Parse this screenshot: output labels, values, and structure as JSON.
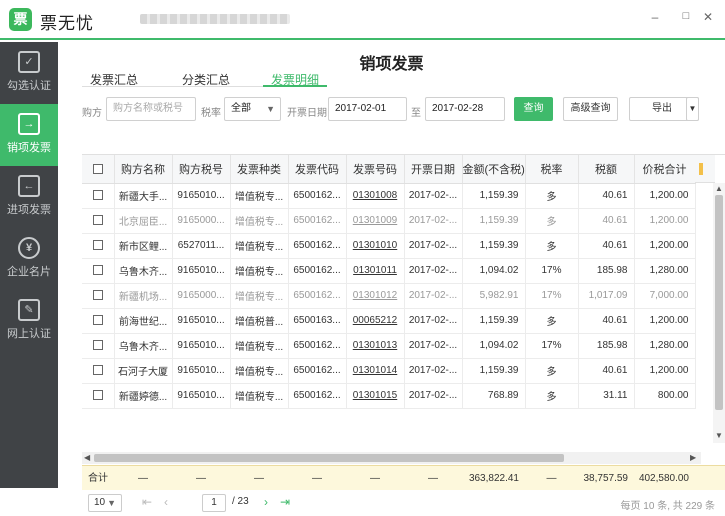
{
  "app": {
    "name": "票无忧",
    "logo_char": "票"
  },
  "window": {
    "minimize": "–",
    "maximize": "□",
    "close": "✕"
  },
  "sidebar": {
    "items": [
      {
        "label": "勾选认证",
        "icon": "checklist-icon",
        "glyph": "✓"
      },
      {
        "label": "销项发票",
        "icon": "invoice-out-icon",
        "glyph": "→"
      },
      {
        "label": "进项发票",
        "icon": "invoice-in-icon",
        "glyph": "←"
      },
      {
        "label": "企业名片",
        "icon": "business-card-icon",
        "glyph": "¥"
      },
      {
        "label": "网上认证",
        "icon": "online-cert-icon",
        "glyph": "✎"
      }
    ]
  },
  "page": {
    "title": "销项发票"
  },
  "tabs": [
    {
      "label": "发票汇总"
    },
    {
      "label": "分类汇总"
    },
    {
      "label": "发票明细"
    }
  ],
  "filters": {
    "buyer_label": "购方",
    "buyer_placeholder": "购方名称或税号",
    "rate_label": "税率",
    "rate_value": "全部",
    "date_label": "开票日期",
    "date_from": "2017-02-01",
    "date_sep": "至",
    "date_to": "2017-02-28",
    "query": "查询",
    "advanced": "高级查询",
    "export": "导出"
  },
  "table": {
    "headers": [
      "购方名称",
      "购方税号",
      "发票种类",
      "发票代码",
      "发票号码",
      "开票日期",
      "金额(不含税)",
      "税率",
      "税额",
      "价税合计"
    ],
    "rows": [
      {
        "c": [
          "新疆大手...",
          "9165010...",
          "增值税专...",
          "6500162...",
          "01301008",
          "2017-02-...",
          "1,159.39",
          "多",
          "40.61",
          "1,200.00"
        ],
        "dim": false
      },
      {
        "c": [
          "北京屈臣...",
          "9165000...",
          "增值税专...",
          "6500162...",
          "01301009",
          "2017-02-...",
          "1,159.39",
          "多",
          "40.61",
          "1,200.00"
        ],
        "dim": true
      },
      {
        "c": [
          "新市区鲤...",
          "6527011...",
          "增值税专...",
          "6500162...",
          "01301010",
          "2017-02-...",
          "1,159.39",
          "多",
          "40.61",
          "1,200.00"
        ],
        "dim": false
      },
      {
        "c": [
          "乌鲁木齐...",
          "9165010...",
          "增值税专...",
          "6500162...",
          "01301011",
          "2017-02-...",
          "1,094.02",
          "17%",
          "185.98",
          "1,280.00"
        ],
        "dim": false
      },
      {
        "c": [
          "新疆机场...",
          "9165000...",
          "增值税专...",
          "6500162...",
          "01301012",
          "2017-02-...",
          "5,982.91",
          "17%",
          "1,017.09",
          "7,000.00"
        ],
        "dim": true
      },
      {
        "c": [
          "前海世纪...",
          "9165010...",
          "增值税普...",
          "6500163...",
          "00065212",
          "2017-02-...",
          "1,159.39",
          "多",
          "40.61",
          "1,200.00"
        ],
        "dim": false
      },
      {
        "c": [
          "乌鲁木齐...",
          "9165010...",
          "增值税专...",
          "6500162...",
          "01301013",
          "2017-02-...",
          "1,094.02",
          "17%",
          "185.98",
          "1,280.00"
        ],
        "dim": false
      },
      {
        "c": [
          "石河子大厦",
          "9165010...",
          "增值税专...",
          "6500162...",
          "01301014",
          "2017-02-...",
          "1,159.39",
          "多",
          "40.61",
          "1,200.00"
        ],
        "dim": false
      },
      {
        "c": [
          "新疆婷德...",
          "9165010...",
          "增值税专...",
          "6500162...",
          "01301015",
          "2017-02-...",
          "768.89",
          "多",
          "31.11",
          "800.00"
        ],
        "dim": false
      }
    ]
  },
  "totals": {
    "label": "合计",
    "dash": "—",
    "amount": "363,822.41",
    "tax": "38,757.59",
    "total": "402,580.00"
  },
  "pager": {
    "page_size": "10",
    "current": "1",
    "total_pages": "/ 23",
    "info": "每页 10 条, 共 229 条"
  }
}
